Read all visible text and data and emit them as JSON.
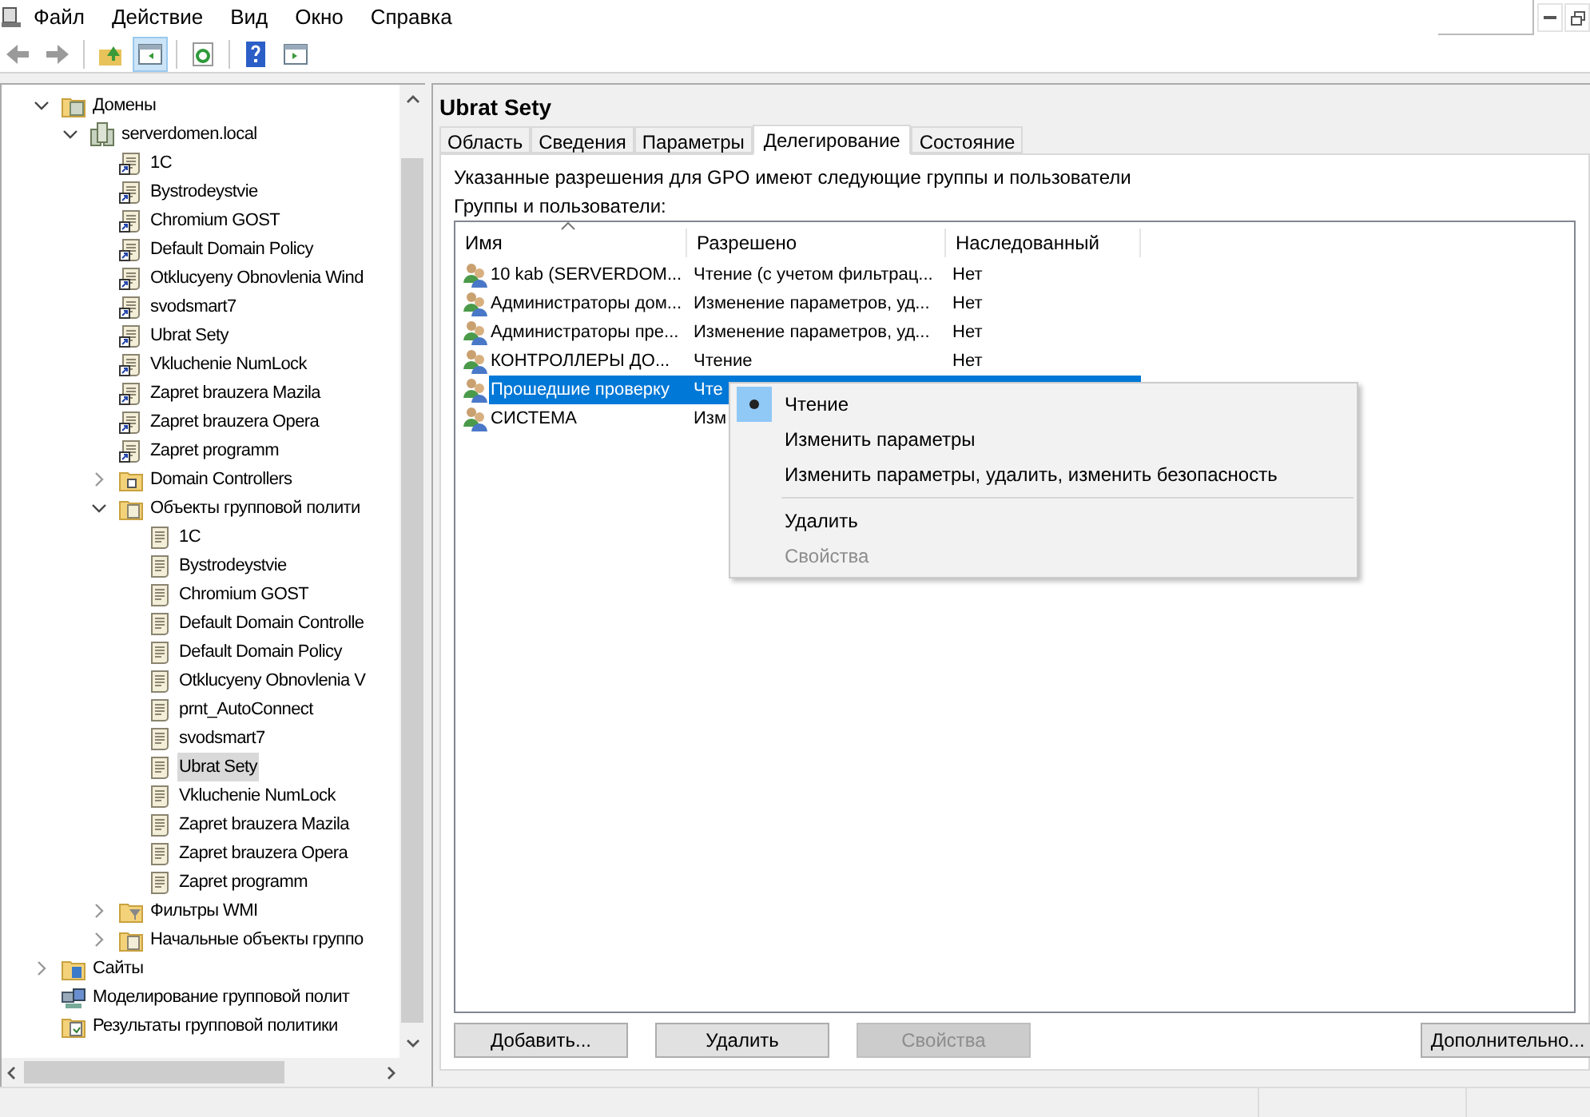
{
  "menu_bar": [
    "Файл",
    "Действие",
    "Вид",
    "Окно",
    "Справка"
  ],
  "toolbar": [
    {
      "kind": "back",
      "pressed": false
    },
    {
      "kind": "forward",
      "pressed": false
    },
    {
      "kind": "sep"
    },
    {
      "kind": "up",
      "pressed": false
    },
    {
      "kind": "tree",
      "pressed": true
    },
    {
      "kind": "sep"
    },
    {
      "kind": "refresh",
      "pressed": false
    },
    {
      "kind": "sep"
    },
    {
      "kind": "help",
      "pressed": false
    },
    {
      "kind": "pane",
      "pressed": false
    }
  ],
  "tree": [
    {
      "label": "Домены",
      "kind": "domains",
      "expanded": true,
      "selected": false,
      "children": [
        {
          "label": "serverdomen.local",
          "kind": "domain",
          "expanded": true,
          "selected": false,
          "children": [
            {
              "label": "1C",
              "kind": "link",
              "selected": false
            },
            {
              "label": "Bystrodeystvie",
              "kind": "link",
              "selected": false
            },
            {
              "label": "Chromium GOST",
              "kind": "link",
              "selected": false
            },
            {
              "label": "Default Domain Policy",
              "kind": "link",
              "selected": false
            },
            {
              "label": "Otklucyeny Obnovlenia Wind",
              "kind": "link",
              "selected": false
            },
            {
              "label": "svodsmart7",
              "kind": "link",
              "selected": false
            },
            {
              "label": "Ubrat Sety",
              "kind": "link",
              "selected": false
            },
            {
              "label": "Vkluchenie NumLock",
              "kind": "link",
              "selected": false
            },
            {
              "label": "Zapret brauzera Mazila",
              "kind": "link",
              "selected": false
            },
            {
              "label": "Zapret brauzera Opera",
              "kind": "link",
              "selected": false
            },
            {
              "label": "Zapret programm",
              "kind": "link",
              "selected": false
            },
            {
              "label": "Domain Controllers",
              "kind": "folder",
              "expanded": false,
              "selected": false
            },
            {
              "label": "Объекты групповой полити",
              "kind": "gpofolder",
              "expanded": true,
              "selected": false,
              "children": [
                {
                  "label": "1C",
                  "kind": "gpo",
                  "selected": false
                },
                {
                  "label": "Bystrodeystvie",
                  "kind": "gpo",
                  "selected": false
                },
                {
                  "label": "Chromium GOST",
                  "kind": "gpo",
                  "selected": false
                },
                {
                  "label": "Default Domain Controlle",
                  "kind": "gpo",
                  "selected": false
                },
                {
                  "label": "Default Domain Policy",
                  "kind": "gpo",
                  "selected": false
                },
                {
                  "label": "Otklucyeny Obnovlenia V",
                  "kind": "gpo",
                  "selected": false
                },
                {
                  "label": "prnt_AutoConnect",
                  "kind": "gpo",
                  "selected": false
                },
                {
                  "label": "svodsmart7",
                  "kind": "gpo",
                  "selected": false
                },
                {
                  "label": "Ubrat Sety",
                  "kind": "gpo",
                  "selected": true
                },
                {
                  "label": "Vkluchenie NumLock",
                  "kind": "gpo",
                  "selected": false
                },
                {
                  "label": "Zapret brauzera Mazila",
                  "kind": "gpo",
                  "selected": false
                },
                {
                  "label": "Zapret brauzera Opera",
                  "kind": "gpo",
                  "selected": false
                },
                {
                  "label": "Zapret programm",
                  "kind": "gpo",
                  "selected": false
                }
              ]
            },
            {
              "label": "Фильтры WMI",
              "kind": "filterfolder",
              "expanded": false,
              "selected": false
            },
            {
              "label": "Начальные объекты группо",
              "kind": "gpofolder",
              "expanded": false,
              "selected": false
            }
          ]
        }
      ]
    },
    {
      "label": "Сайты",
      "kind": "sites",
      "expanded": false,
      "selected": false
    },
    {
      "label": "Моделирование групповой полит",
      "kind": "modeling",
      "selected": false
    },
    {
      "label": "Результаты групповой политики",
      "kind": "results",
      "selected": false
    }
  ],
  "panel": {
    "title": "Ubrat Sety",
    "tabs": [
      {
        "label": "Область",
        "selected": false
      },
      {
        "label": "Сведения",
        "selected": false
      },
      {
        "label": "Параметры",
        "selected": false
      },
      {
        "label": "Делегирование",
        "selected": true
      },
      {
        "label": "Состояние",
        "selected": false
      }
    ],
    "description": "Указанные разрешения для GPO имеют следующие группы и пользователи",
    "list_label": "Группы и пользователи:",
    "table": {
      "columns": [
        "Имя",
        "Разрешено",
        "Наследованный"
      ],
      "rows": [
        {
          "name": "10 kab (SERVERDOM...",
          "permission": "Чтение (с учетом фильтрац...",
          "inherited": "Нет",
          "selected": false
        },
        {
          "name": "Администраторы дом...",
          "permission": "Изменение параметров, уд...",
          "inherited": "Нет",
          "selected": false
        },
        {
          "name": "Администраторы пре...",
          "permission": "Изменение параметров, уд...",
          "inherited": "Нет",
          "selected": false
        },
        {
          "name": "КОНТРОЛЛЕРЫ ДО...",
          "permission": "Чтение",
          "inherited": "Нет",
          "selected": false
        },
        {
          "name": "Прошедшие проверку",
          "permission": "Чте",
          "selected": true
        },
        {
          "name": "СИСТЕМА",
          "permission": "Изм",
          "selected": false
        }
      ]
    },
    "buttons": [
      {
        "label": "Добавить...",
        "disabled": false
      },
      {
        "label": "Удалить",
        "disabled": false
      },
      {
        "label": "Свойства",
        "disabled": true
      },
      {
        "label": "Дополнительно...",
        "disabled": false
      }
    ]
  },
  "context_menu": [
    {
      "kind": "item",
      "label": "Чтение",
      "checked": true,
      "disabled": false
    },
    {
      "kind": "item",
      "label": "Изменить параметры",
      "checked": false,
      "disabled": false
    },
    {
      "kind": "item",
      "label": "Изменить параметры, удалить, изменить безопасность",
      "checked": false,
      "disabled": false
    },
    {
      "kind": "separator"
    },
    {
      "kind": "item",
      "label": "Удалить",
      "checked": false,
      "disabled": false
    },
    {
      "kind": "item",
      "label": "Свойства",
      "checked": false,
      "disabled": true
    }
  ]
}
